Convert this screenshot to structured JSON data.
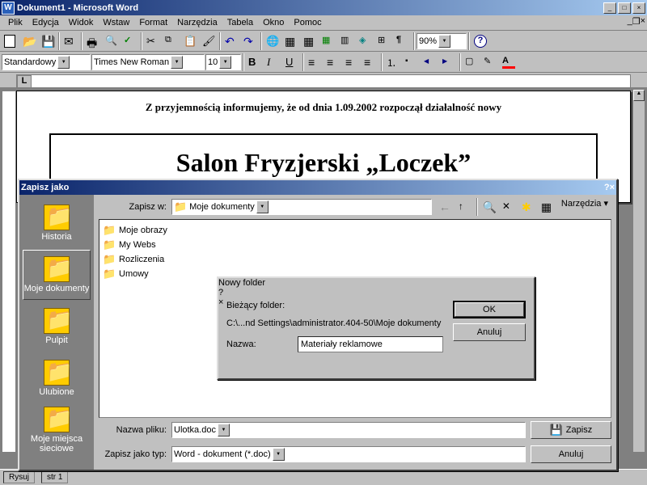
{
  "app": {
    "title": "Dokument1 - Microsoft Word"
  },
  "menu": {
    "items": [
      "Plik",
      "Edycja",
      "Widok",
      "Wstaw",
      "Format",
      "Narzędzia",
      "Tabela",
      "Okno",
      "Pomoc"
    ]
  },
  "format_toolbar": {
    "style": "Standardowy",
    "font": "Times New Roman",
    "size": "10",
    "zoom": "90%"
  },
  "document": {
    "intro_line": "Z przyjemnością informujemy, że od dnia 1.09.2002 rozpoczął działalność nowy",
    "headline": "Salon Fryzjerski  „Loczek”"
  },
  "statusbar": {
    "page": "str 1",
    "draw_tab": "Rysuj"
  },
  "save_dialog": {
    "title": "Zapisz jako",
    "save_in_label": "Zapisz w:",
    "save_in_value": "Moje dokumenty",
    "tools_label": "Narzędzia",
    "places": {
      "history": "Historia",
      "mydocs": "Moje dokumenty",
      "desktop": "Pulpit",
      "favorites": "Ulubione",
      "network": "Moje miejsca sieciowe"
    },
    "files": [
      "Moje obrazy",
      "My Webs",
      "Rozliczenia",
      "Umowy"
    ],
    "filename_label": "Nazwa pliku:",
    "filename_value": "Ulotka.doc",
    "filetype_label": "Zapisz jako typ:",
    "filetype_value": "Word - dokument (*.doc)",
    "save_btn": "Zapisz",
    "cancel_btn": "Anuluj"
  },
  "newfolder_dialog": {
    "title": "Nowy folder",
    "current_folder_label": "Bieżący folder:",
    "current_folder_path": "C:\\...nd Settings\\administrator.404-50\\Moje dokumenty",
    "name_label": "Nazwa:",
    "name_value": "Materiały reklamowe",
    "ok_btn": "OK",
    "cancel_btn": "Anuluj"
  }
}
